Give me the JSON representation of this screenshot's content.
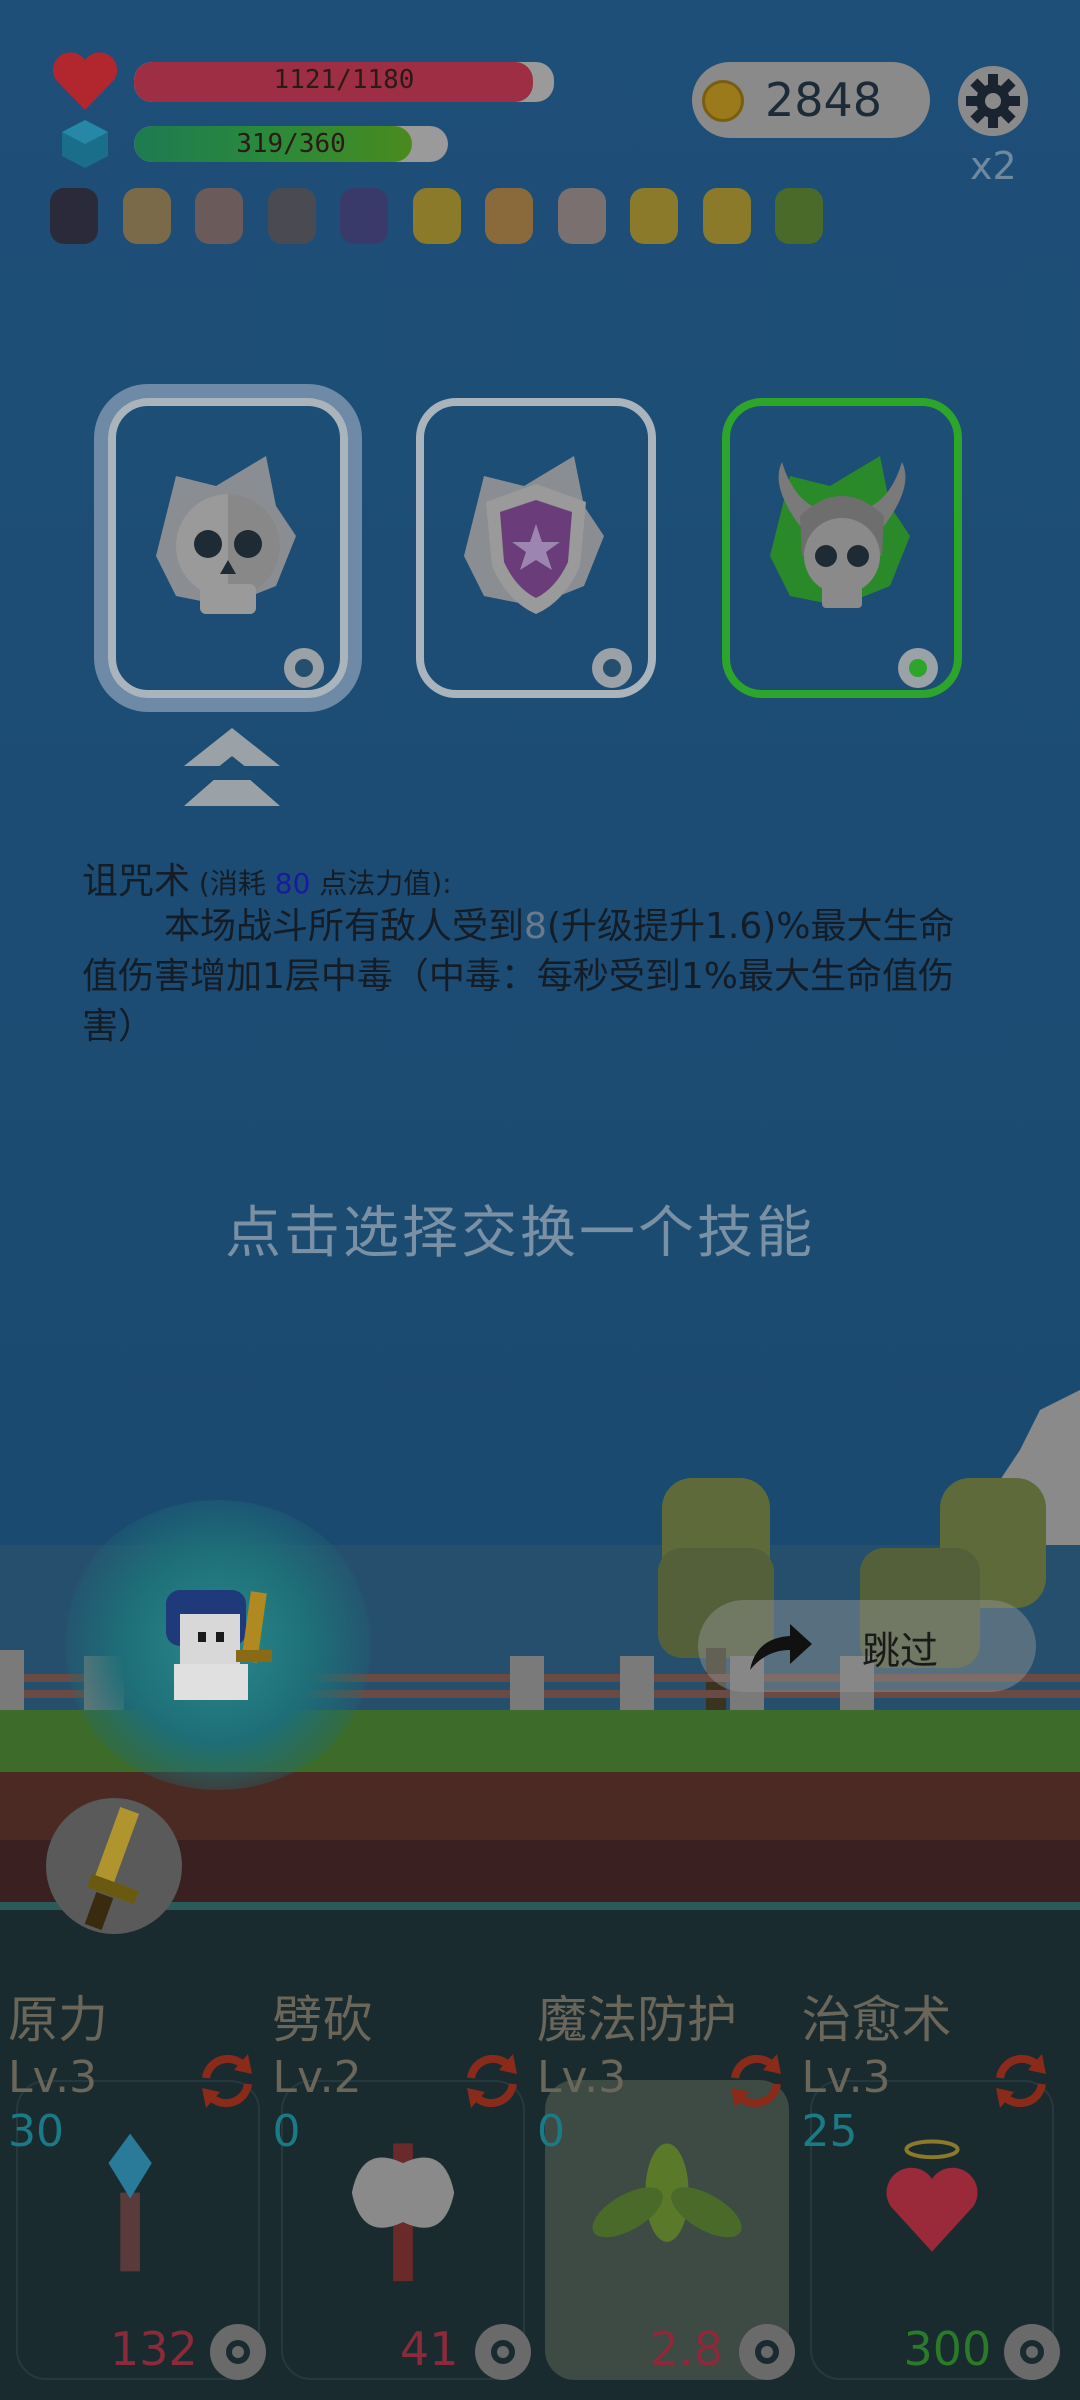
{
  "status": {
    "hp": {
      "text": "1121/1180",
      "fraction": 0.95
    },
    "mp": {
      "text": "319/360",
      "fraction": 0.886
    },
    "coins": "2848",
    "speed": "x2"
  },
  "inventory": [
    "bat-icon",
    "bullets-icon",
    "ice-cream-icon",
    "spiked-club-icon",
    "wizard-hat-icon",
    "ring-icon",
    "fist-icon",
    "hook-icon",
    "ring-icon",
    "eye-icon",
    "sapling-icon"
  ],
  "choices": [
    {
      "icon": "skull-icon",
      "selected": true
    },
    {
      "icon": "shield-icon",
      "selected": false
    },
    {
      "icon": "horned-skull-icon",
      "selected": false,
      "highlight": "#2ca52a"
    }
  ],
  "description": {
    "name": "诅咒术",
    "cost_prefix": " (消耗 ",
    "cost_value": "80",
    "cost_suffix": " 点法力值):",
    "body_pre": "本场战斗所有敌人受到",
    "body_value": "8",
    "body_post": "(升级提升1.6)%最大生命值伤害增加1层中毒（中毒：每秒受到1%最大生命值伤害）"
  },
  "prompt": "点击选择交换一个技能",
  "skip_label": "跳过",
  "skills": [
    {
      "name": "原力",
      "level": "Lv.3",
      "count": "30",
      "value": "132",
      "value_color": "#8a2a3a",
      "icon": "crystal-staff-icon",
      "highlighted": false
    },
    {
      "name": "劈砍",
      "level": "Lv.2",
      "count": "0",
      "value": "41",
      "value_color": "#8a2a3a",
      "icon": "battle-axe-icon",
      "highlighted": false
    },
    {
      "name": "魔法防护",
      "level": "Lv.3",
      "count": "0",
      "value": "2.8",
      "value_color": "#8a2a3a",
      "icon": "leaf-icon",
      "highlighted": true
    },
    {
      "name": "治愈术",
      "level": "Lv.3",
      "count": "25",
      "value": "300",
      "value_color": "#2a7a2a",
      "icon": "winged-heart-icon",
      "highlighted": false
    }
  ]
}
